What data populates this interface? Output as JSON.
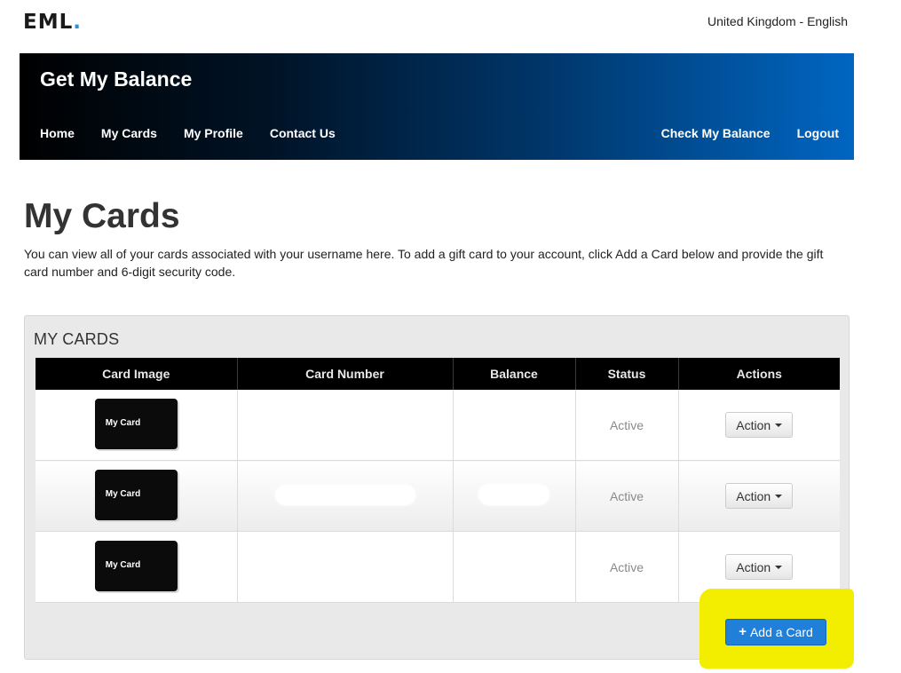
{
  "topbar": {
    "logo_text": "EML",
    "logo_dot": ".",
    "locale": "United Kingdom - English"
  },
  "header": {
    "title": "Get My Balance",
    "nav_left": [
      "Home",
      "My Cards",
      "My Profile",
      "Contact Us"
    ],
    "nav_right": [
      "Check My Balance",
      "Logout"
    ]
  },
  "page": {
    "title": "My Cards",
    "intro": "You can view all of your cards associated with your username here. To add a gift card to your account, click Add a Card below and provide the gift card number and 6-digit security code."
  },
  "panel": {
    "title": "MY CARDS",
    "columns": [
      "Card Image",
      "Card Number",
      "Balance",
      "Status",
      "Actions"
    ],
    "rows": [
      {
        "card_label": "My Card",
        "card_number": "",
        "balance": "",
        "status": "Active",
        "action_label": "Action"
      },
      {
        "card_label": "My Card",
        "card_number": "",
        "balance": "",
        "status": "Active",
        "action_label": "Action"
      },
      {
        "card_label": "My Card",
        "card_number": "",
        "balance": "",
        "status": "Active",
        "action_label": "Action"
      }
    ],
    "add_button_label": "Add a Card",
    "add_button_icon": "+"
  },
  "colors": {
    "header_gradient_start": "#000000",
    "header_gradient_end": "#0066c2",
    "primary_button": "#1f7fd9",
    "highlight": "#f3ee00"
  }
}
